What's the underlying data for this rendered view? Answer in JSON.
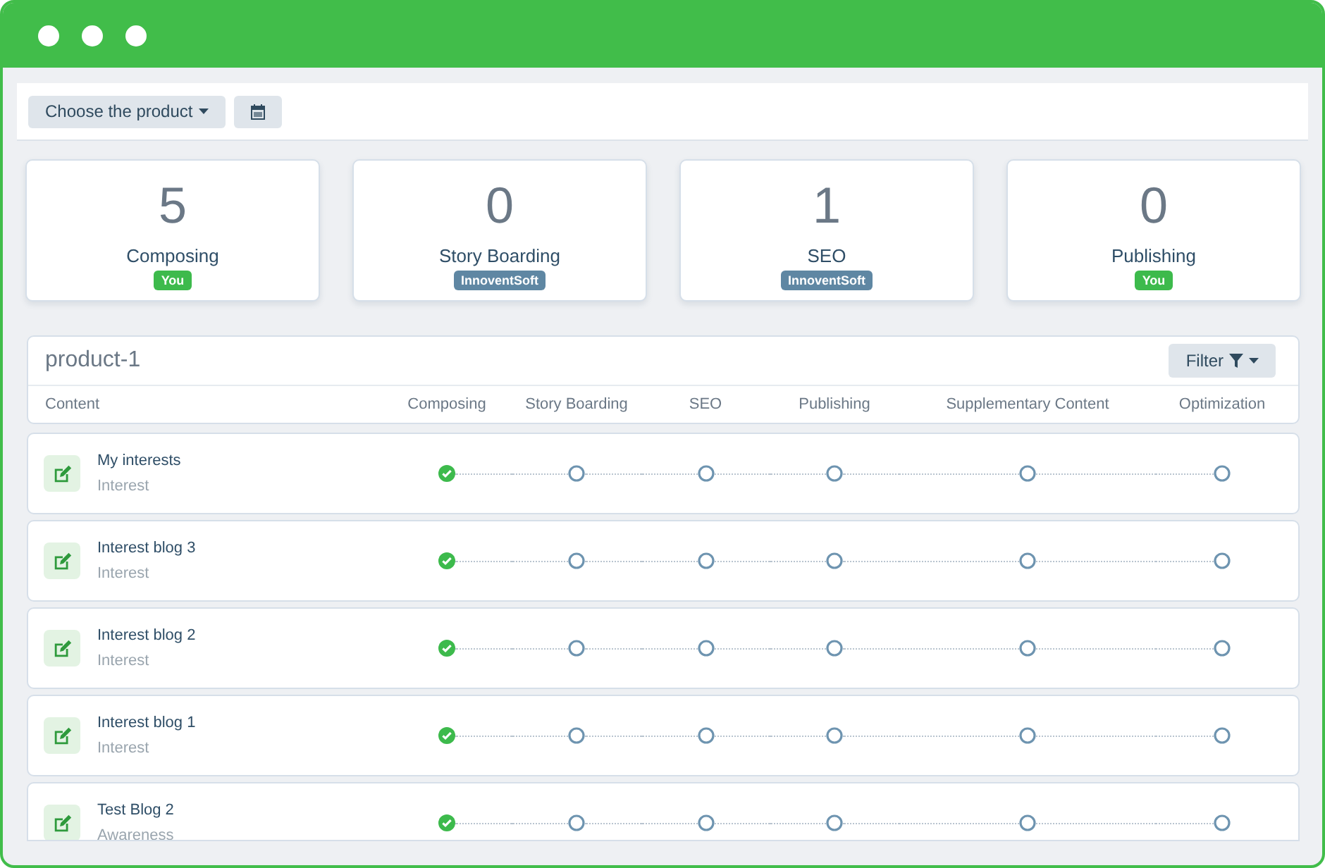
{
  "toolbar": {
    "product_button": "Choose the product"
  },
  "stats": [
    {
      "count": "5",
      "label": "Composing",
      "badge": "You",
      "color": "#3dba4c"
    },
    {
      "count": "0",
      "label": "Story Boarding",
      "badge": "InnoventSoft",
      "color": "#5f87a3"
    },
    {
      "count": "1",
      "label": "SEO",
      "badge": "InnoventSoft",
      "color": "#5f87a3"
    },
    {
      "count": "0",
      "label": "Publishing",
      "badge": "You",
      "color": "#3dba4c"
    }
  ],
  "panel": {
    "title": "product-1",
    "filter_button": "Filter",
    "columns": [
      "Content",
      "Composing",
      "Story Boarding",
      "SEO",
      "Publishing",
      "Supplementary Content",
      "Optimization"
    ],
    "rows": [
      {
        "name": "My interests",
        "category": "Interest",
        "stages": [
          {
            "done": true
          },
          {
            "done": false
          },
          {
            "done": false
          },
          {
            "done": false
          },
          {
            "done": false
          },
          {
            "done": false
          }
        ]
      },
      {
        "name": "Interest blog 3",
        "category": "Interest",
        "stages": [
          {
            "done": true
          },
          {
            "done": false
          },
          {
            "done": false
          },
          {
            "done": false
          },
          {
            "done": false
          },
          {
            "done": false
          }
        ]
      },
      {
        "name": "Interest blog 2",
        "category": "Interest",
        "stages": [
          {
            "done": true
          },
          {
            "done": false
          },
          {
            "done": false
          },
          {
            "done": false
          },
          {
            "done": false
          },
          {
            "done": false
          }
        ]
      },
      {
        "name": "Interest blog 1",
        "category": "Interest",
        "stages": [
          {
            "done": true
          },
          {
            "done": false
          },
          {
            "done": false
          },
          {
            "done": false
          },
          {
            "done": false
          },
          {
            "done": false
          }
        ]
      },
      {
        "name": "Test Blog 2",
        "category": "Awareness",
        "stages": [
          {
            "done": true
          },
          {
            "done": false
          },
          {
            "done": false
          },
          {
            "done": false
          },
          {
            "done": false
          },
          {
            "done": false
          }
        ]
      }
    ]
  }
}
